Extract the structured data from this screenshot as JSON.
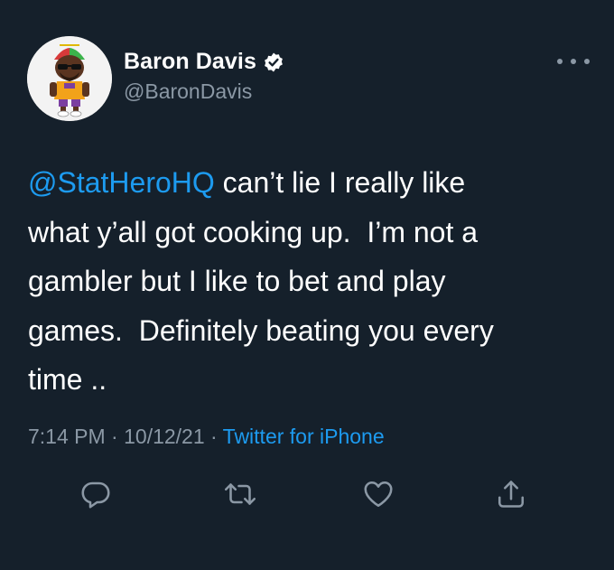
{
  "author": {
    "display_name": "Baron Davis",
    "handle": "@BaronDavis",
    "verified": true,
    "verified_color": "#ffffff",
    "avatar_icon": "cartoon-character-avatar"
  },
  "menu": {
    "icon": "more-horizontal-icon"
  },
  "tweet": {
    "mention": "@StatHeroHQ",
    "lines": [
      " can’t lie I really like",
      "what y’all got cooking up.  I’m not a",
      "gambler but I like to bet and play",
      "games.  Definitely beating you every",
      "time .."
    ]
  },
  "meta": {
    "time": "7:14 PM",
    "separator": " · ",
    "date": "10/12/21",
    "source": "Twitter for iPhone"
  },
  "actions": [
    {
      "name": "reply",
      "icon": "reply-icon"
    },
    {
      "name": "retweet",
      "icon": "retweet-icon"
    },
    {
      "name": "like",
      "icon": "heart-icon"
    },
    {
      "name": "share",
      "icon": "share-icon"
    }
  ],
  "colors": {
    "background": "#15202b",
    "text": "#ffffff",
    "secondary": "#8b98a5",
    "accent": "#1d9bf0"
  }
}
